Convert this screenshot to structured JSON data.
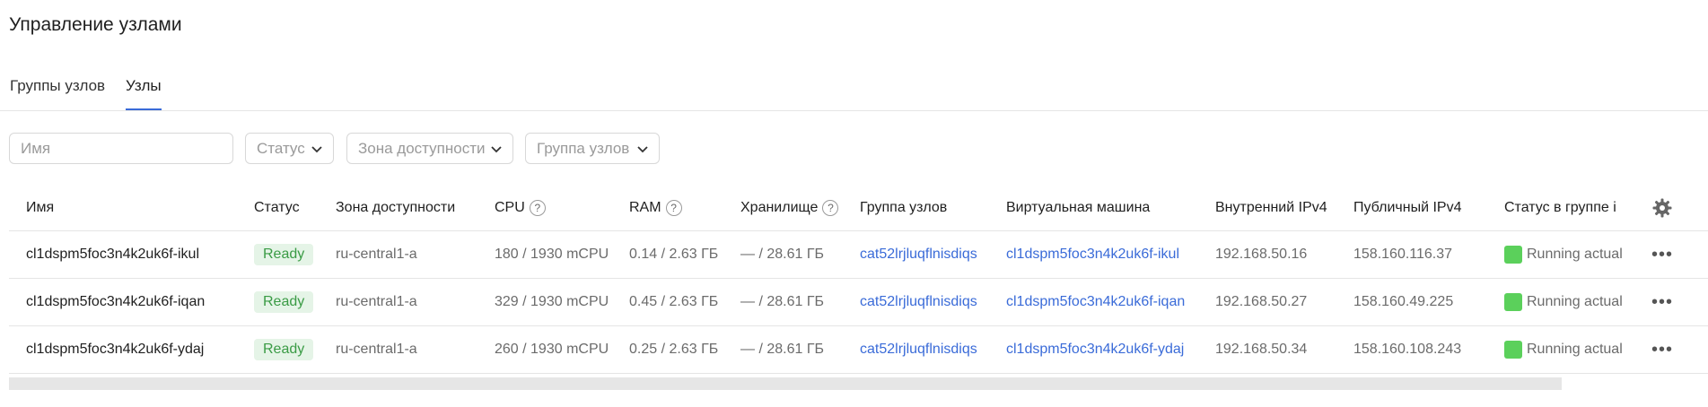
{
  "page": {
    "title": "Управление узлами"
  },
  "tabs": [
    {
      "label": "Группы узлов",
      "active": false
    },
    {
      "label": "Узлы",
      "active": true
    }
  ],
  "filters": {
    "name_placeholder": "Имя",
    "status_label": "Статус",
    "zone_label": "Зона доступности",
    "group_label": "Группа узлов"
  },
  "table": {
    "headers": {
      "name": "Имя",
      "status": "Статус",
      "zone": "Зона доступности",
      "cpu": "CPU",
      "ram": "RAM",
      "storage": "Хранилище",
      "group": "Группа узлов",
      "vm": "Виртуальная машина",
      "internal_ip": "Внутренний IPv4",
      "public_ip": "Публичный IPv4",
      "group_status": "Статус в группе і"
    },
    "help_glyph": "?",
    "rows": [
      {
        "name": "cl1dspm5foc3n4k2uk6f-ikul",
        "status": "Ready",
        "zone": "ru-central1-a",
        "cpu": "180 / 1930 mCPU",
        "ram": "0.14 / 2.63 ГБ",
        "storage": "— / 28.61 ГБ",
        "group": "cat52lrjluqflnisdiqs",
        "vm": "cl1dspm5foc3n4k2uk6f-ikul",
        "internal_ip": "192.168.50.16",
        "public_ip": "158.160.116.37",
        "group_status": "Running actual"
      },
      {
        "name": "cl1dspm5foc3n4k2uk6f-iqan",
        "status": "Ready",
        "zone": "ru-central1-a",
        "cpu": "329 / 1930 mCPU",
        "ram": "0.45 / 2.63 ГБ",
        "storage": "— / 28.61 ГБ",
        "group": "cat52lrjluqflnisdiqs",
        "vm": "cl1dspm5foc3n4k2uk6f-iqan",
        "internal_ip": "192.168.50.27",
        "public_ip": "158.160.49.225",
        "group_status": "Running actual"
      },
      {
        "name": "cl1dspm5foc3n4k2uk6f-ydaj",
        "status": "Ready",
        "zone": "ru-central1-a",
        "cpu": "260 / 1930 mCPU",
        "ram": "0.25 / 2.63 ГБ",
        "storage": "— / 28.61 ГБ",
        "group": "cat52lrjluqflnisdiqs",
        "vm": "cl1dspm5foc3n4k2uk6f-ydaj",
        "internal_ip": "192.168.50.34",
        "public_ip": "158.160.108.243",
        "group_status": "Running actual"
      }
    ],
    "more_glyph": "•••"
  },
  "icons": {
    "chevron": "chevron-down-icon",
    "gear": "gear-icon",
    "more": "more-dots-icon",
    "help": "question-circle-icon",
    "status_square": "green-square-icon"
  },
  "colors": {
    "accent": "#3a6bd8",
    "ready_bg": "#e5f4e7",
    "ready_text": "#3a9b45",
    "running": "#5bd05b"
  }
}
